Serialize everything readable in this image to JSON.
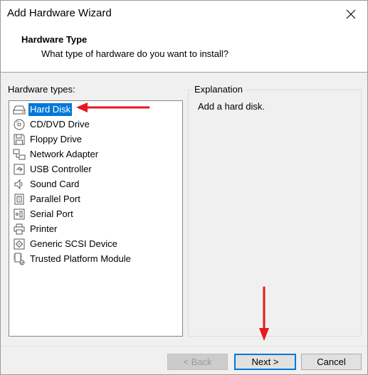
{
  "window": {
    "title": "Add Hardware Wizard",
    "close_glyph": "✕"
  },
  "header": {
    "title": "Hardware Type",
    "subtitle": "What type of hardware do you want to install?"
  },
  "hardware_types": {
    "label": "Hardware types:",
    "selected_index": 0,
    "items": [
      {
        "label": "Hard Disk",
        "icon": "hard-disk-icon"
      },
      {
        "label": "CD/DVD Drive",
        "icon": "cd-dvd-icon"
      },
      {
        "label": "Floppy Drive",
        "icon": "floppy-icon"
      },
      {
        "label": "Network Adapter",
        "icon": "network-icon"
      },
      {
        "label": "USB Controller",
        "icon": "usb-icon"
      },
      {
        "label": "Sound Card",
        "icon": "sound-icon"
      },
      {
        "label": "Parallel Port",
        "icon": "parallel-port-icon"
      },
      {
        "label": "Serial Port",
        "icon": "serial-port-icon"
      },
      {
        "label": "Printer",
        "icon": "printer-icon"
      },
      {
        "label": "Generic SCSI Device",
        "icon": "scsi-icon"
      },
      {
        "label": "Trusted Platform Module",
        "icon": "tpm-icon"
      }
    ]
  },
  "explanation": {
    "legend": "Explanation",
    "text": "Add a hard disk."
  },
  "buttons": {
    "back": "< Back",
    "next": "Next >",
    "cancel": "Cancel"
  },
  "colors": {
    "selection": "#0078d7",
    "annotation_arrow": "#e8171d"
  }
}
